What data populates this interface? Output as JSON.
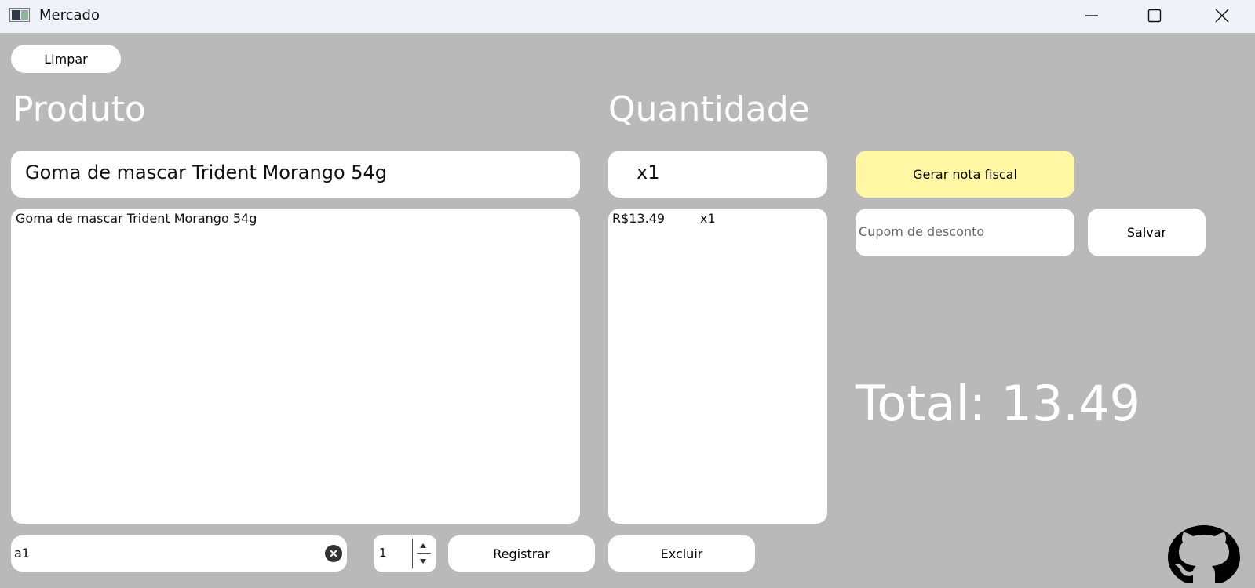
{
  "window": {
    "title": "Mercado"
  },
  "toolbar": {
    "clear_label": "Limpar"
  },
  "labels": {
    "product": "Produto",
    "quantity": "Quantidade"
  },
  "product_field": {
    "value": "Goma de mascar Trident Morango 54g"
  },
  "quantity_field": {
    "value": "x1"
  },
  "product_list": [
    "Goma de mascar Trident Morango 54g"
  ],
  "quantity_list": [
    {
      "price": "R$13.49",
      "qty": "x1"
    }
  ],
  "actions": {
    "generate_invoice": "Gerar nota fiscal",
    "save": "Salvar",
    "register": "Registrar",
    "delete": "Excluir"
  },
  "coupon": {
    "placeholder": "Cupom de desconto"
  },
  "total": {
    "text": "Total: 13.49"
  },
  "search": {
    "value": "a1"
  },
  "spinner": {
    "value": "1"
  },
  "colors": {
    "background": "#b9b9b9",
    "accent": "#fff7a3",
    "titlebar": "#eff3f9"
  },
  "icons": [
    "app-icon",
    "minimize-icon",
    "maximize-icon",
    "close-icon",
    "clear-search-icon",
    "github-icon"
  ]
}
